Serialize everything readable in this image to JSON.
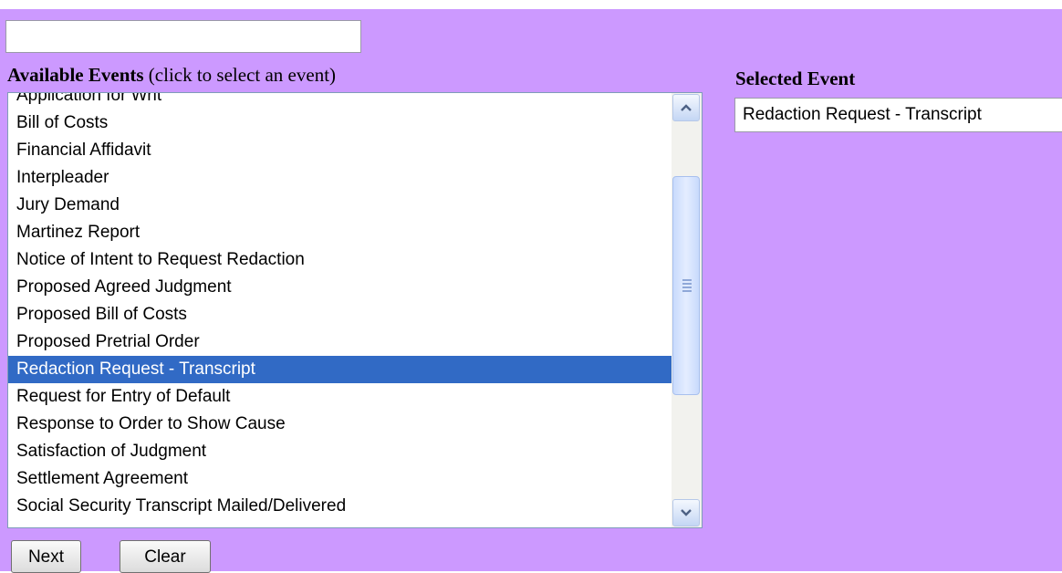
{
  "search": {
    "value": "",
    "placeholder": ""
  },
  "available": {
    "heading_bold": "Available Events",
    "heading_hint": " (click to select an event)",
    "items": [
      "Application for Writ",
      "Bill of Costs",
      "Financial Affidavit",
      "Interpleader",
      "Jury Demand",
      "Martinez Report",
      "Notice of Intent to Request Redaction",
      "Proposed Agreed Judgment",
      "Proposed Bill of Costs",
      "Proposed Pretrial Order",
      "Redaction Request - Transcript",
      "Request for Entry of Default",
      "Response to Order to Show Cause",
      "Satisfaction of Judgment",
      "Settlement Agreement",
      "Social Security Transcript Mailed/Delivered"
    ],
    "selected_index": 10
  },
  "selected_event": {
    "heading": "Selected Event",
    "value": "Redaction Request - Transcript"
  },
  "buttons": {
    "next": "Next",
    "clear": "Clear"
  },
  "icons": {
    "scroll_up": "chevron-up-icon",
    "scroll_down": "chevron-down-icon"
  },
  "colors": {
    "background": "#cc99ff",
    "selection": "#316ac5",
    "list_border": "#7f9db9"
  }
}
